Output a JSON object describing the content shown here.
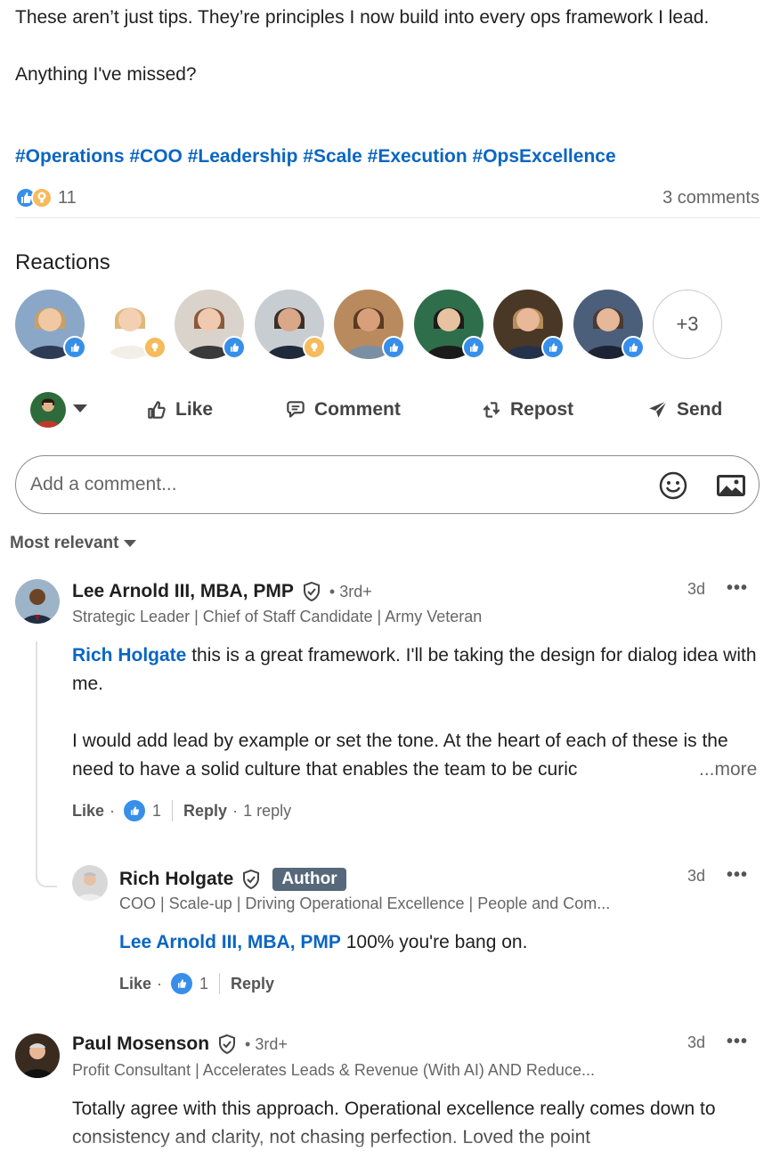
{
  "post": {
    "text_line1": "These aren’t just tips. They’re principles I now build into every ops framework I lead.",
    "text_line2": "Anything I've missed?",
    "hashtags": "#Operations #COO #Leadership #Scale #Execution #OpsExcellence",
    "reaction_count": "11",
    "comments_count": "3 comments"
  },
  "reactions": {
    "title": "Reactions",
    "more_label": "+3",
    "avatars": [
      {
        "reaction": "like",
        "skin": "#f0c8a4",
        "hair": "#c9a064",
        "bg": "#8aa7c7",
        "shirt": "#2e3b55"
      },
      {
        "reaction": "insight",
        "skin": "#f3d0b4",
        "hair": "#e0b878",
        "bg": "#ffffff",
        "shirt": "#f2efe8"
      },
      {
        "reaction": "like",
        "skin": "#efcab0",
        "hair": "#8a5a3a",
        "bg": "#d9d3cc",
        "shirt": "#3a3a3a"
      },
      {
        "reaction": "insight",
        "skin": "#d9a888",
        "hair": "#3b3029",
        "bg": "#c8cdd2",
        "shirt": "#1f2a3a"
      },
      {
        "reaction": "like",
        "skin": "#d8a07a",
        "hair": "#5a3b22",
        "bg": "#b98a5d",
        "shirt": "#7a8fa3"
      },
      {
        "reaction": "like",
        "skin": "#e7c2a0",
        "hair": "#1b1b1b",
        "bg": "#2f6e4a",
        "shirt": "#1b1b1b"
      },
      {
        "reaction": "like",
        "skin": "#e9b898",
        "hair": "#b58c5a",
        "bg": "#4a3826",
        "shirt": "#23324a"
      },
      {
        "reaction": "like",
        "skin": "#e4b898",
        "hair": "#4a3b30",
        "bg": "#4b5e7a",
        "shirt": "#1c2433"
      }
    ]
  },
  "actions": {
    "like": "Like",
    "comment": "Comment",
    "repost": "Repost",
    "send": "Send"
  },
  "comment_input": {
    "placeholder": "Add a comment..."
  },
  "sort": {
    "label": "Most relevant"
  },
  "comments": [
    {
      "name": "Lee Arnold III, MBA, PMP",
      "degree": "• 3rd+",
      "headline": "Strategic Leader | Chief of Staff Candidate | Army Veteran",
      "time": "3d",
      "mention": "Rich Holgate",
      "body1": " this is a great framework. I'll be taking the design for dialog idea with me.",
      "body2": "I would add lead by example or set the tone. At the heart of each of these is the need to have a solid culture that enables the team to be curic",
      "see_more": "...more",
      "like_label": "Like",
      "like_count": "1",
      "reply_label": "Reply",
      "replies": "1 reply"
    },
    {
      "name": "Rich Holgate",
      "author_badge": "Author",
      "headline": "COO | Scale-up | Driving Operational Excellence | People and Com...",
      "time": "3d",
      "mention": "Lee Arnold III, MBA, PMP",
      "body1": " 100% you're bang on.",
      "like_label": "Like",
      "like_count": "1",
      "reply_label": "Reply"
    },
    {
      "name": "Paul Mosenson",
      "degree": "• 3rd+",
      "headline": "Profit Consultant | Accelerates Leads & Revenue (With AI) AND Reduce...",
      "time": "3d",
      "body1": "Totally agree with this approach. Operational excellence really comes down to consistency and clarity, not chasing perfection. Loved the point"
    }
  ],
  "more_menu": "•••",
  "colors": {
    "link": "#0a66c2",
    "like": "#378fe9",
    "insight": "#f5bb5c",
    "author_badge": "#56687a"
  }
}
